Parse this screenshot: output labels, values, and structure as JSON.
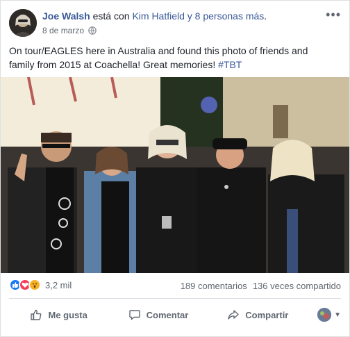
{
  "post": {
    "author": "Joe Walsh",
    "with_text": " está con ",
    "tagged": "Kim Hatfield y 8 personas más",
    "tagged_suffix": ".",
    "date": "8 de marzo",
    "privacy_icon": "globe-icon",
    "more_icon": "more-icon",
    "text_main": "On tour/EAGLES here in Australia and found this photo of friends and family from 2015 at Coachella! Great memories! ",
    "hashtag": "#TBT"
  },
  "stats": {
    "reactions": [
      "like",
      "love",
      "wow"
    ],
    "reaction_count": "3,2 mil",
    "comments": "189 comentarios",
    "shares": "136 veces compartido"
  },
  "actions": {
    "like": "Me gusta",
    "comment": "Comentar",
    "share": "Compartir"
  },
  "colors": {
    "link": "#385898",
    "like": "#1877f2",
    "love": "#f33e58",
    "wow": "#f7b125"
  }
}
